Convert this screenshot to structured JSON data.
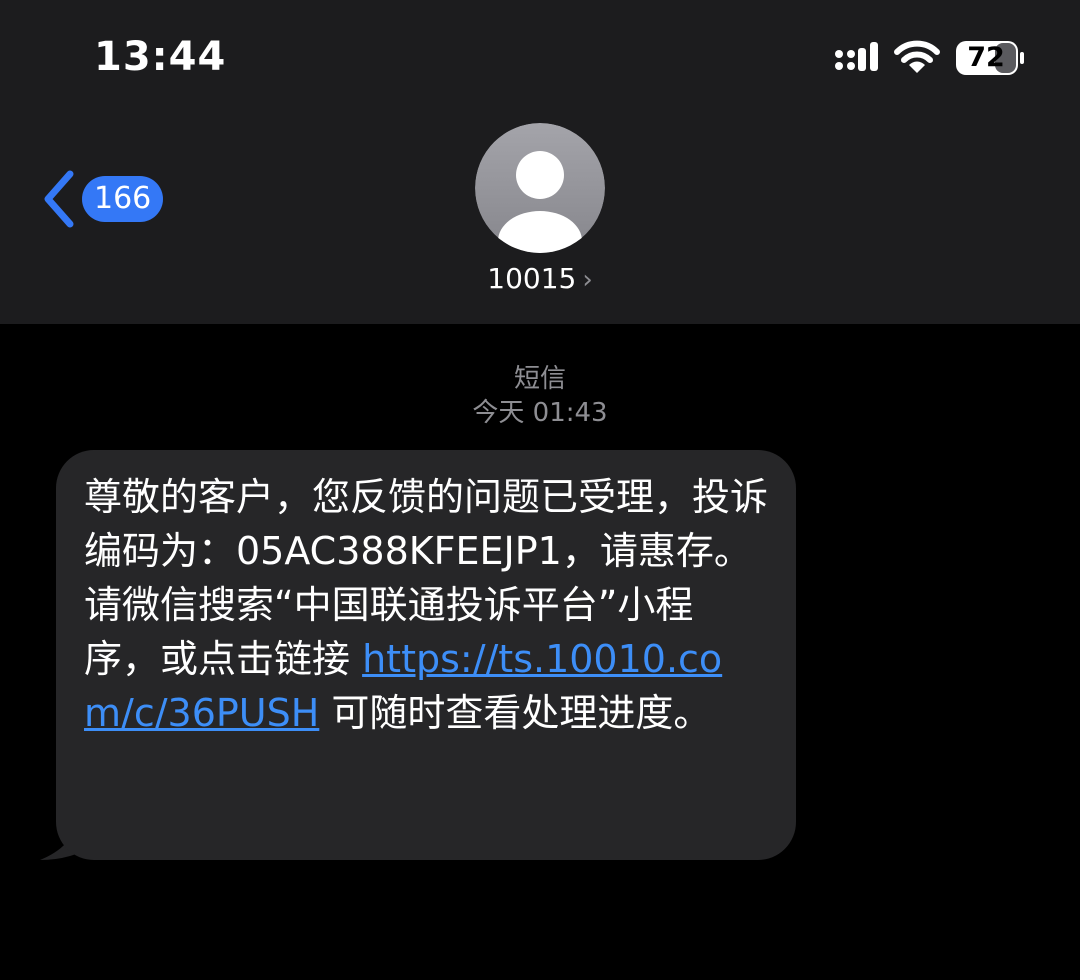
{
  "status_bar": {
    "time": "13:44",
    "battery_level": "72"
  },
  "nav": {
    "back_count": "166",
    "contact_name": "10015",
    "contact_chevron": "›"
  },
  "thread": {
    "service_label": "短信",
    "timestamp": "今天 01:43"
  },
  "message": {
    "text_before_link": "尊敬的客户，您反馈的问题已受理，投诉编码为：05AC388KFEEJP1，请惠存。请微信搜索“中国联通投诉平台”小程序，或点击链接 ",
    "link": "https://ts.10010.com/c/36PUSH",
    "text_after_link": " 可随时查看处理进度。"
  },
  "colors": {
    "accent": "#3478f6",
    "link": "#3d8ef7",
    "bubble": "#262628",
    "header": "#1c1c1e",
    "secondary_text": "#8e8e93"
  },
  "icons": {
    "signal": "cellular-signal-icon",
    "wifi": "wifi-icon",
    "battery": "battery-icon",
    "back": "chevron-left-icon",
    "avatar": "person-icon",
    "contact_chevron": "chevron-right-icon"
  }
}
